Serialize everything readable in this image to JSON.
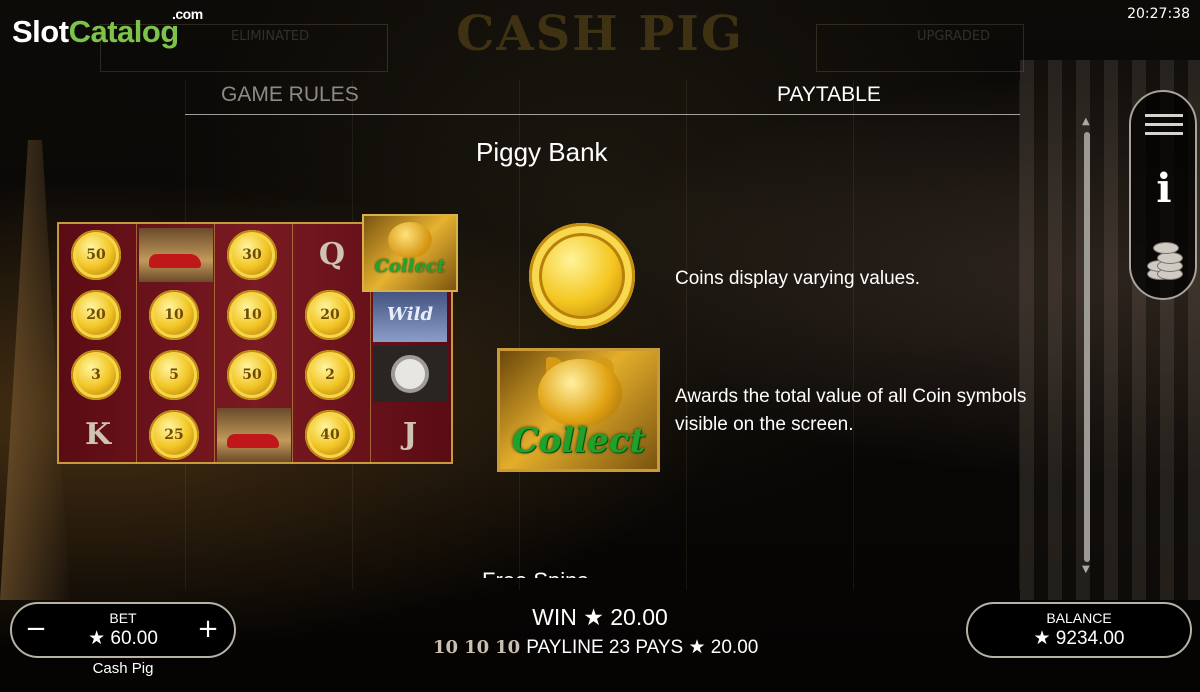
{
  "brand": {
    "slot": "Slot",
    "catalog": "Catalog",
    "dotcom": ".com"
  },
  "clock": "20:27:38",
  "background": {
    "title": "CASH PIG",
    "left_label": "ELIMINATED",
    "right_label": "UPGRADED"
  },
  "tabs": [
    {
      "label": "GAME RULES",
      "active": false
    },
    {
      "label": "PAYTABLE",
      "active": true
    }
  ],
  "paytable": {
    "section_title": "Piggy Bank",
    "next_section_title": "Free Spins",
    "items": [
      {
        "icon": "gold-coin",
        "text": "Coins display varying values."
      },
      {
        "icon": "piggy-bank-collect",
        "symbol_text": "Collect",
        "text": "Awards the total value of all Coin symbols visible on the screen."
      }
    ],
    "example_grid": {
      "collect_symbol_text": "Collect",
      "wild_text": "Wild",
      "coins": [
        "50",
        "20",
        "10",
        "3",
        "5",
        "30",
        "10",
        "50",
        "25",
        "20",
        "2",
        "40"
      ],
      "letters": [
        "Q",
        "K",
        "J"
      ]
    }
  },
  "sidebar": {
    "menu": "menu-icon",
    "info": "i",
    "coins": "coins-stack-icon"
  },
  "bet": {
    "label": "BET",
    "value": "★ 60.00",
    "minus": "−",
    "plus": "+"
  },
  "game_name": "Cash Pig",
  "win": {
    "text": "WIN ★ 20.00"
  },
  "payline": {
    "symbols": [
      "10",
      "10",
      "10"
    ],
    "text": "PAYLINE 23 PAYS ★ 20.00"
  },
  "balance": {
    "label": "BALANCE",
    "value": "★ 9234.00"
  },
  "colors": {
    "brand_green": "#7dc24b",
    "gold": "#f2c525",
    "collect_green": "#1ea22a",
    "reel_red": "#7a1a22"
  }
}
